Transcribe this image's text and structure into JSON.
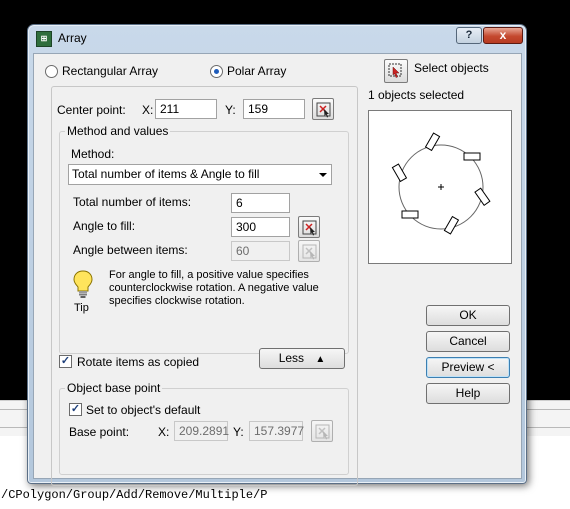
{
  "background": {
    "command_line": "/CPolygon/Group/Add/Remove/Multiple/P"
  },
  "titlebar": {
    "title": "Array",
    "icon": "array-app-icon",
    "help_glyph": "?",
    "close_glyph": "x"
  },
  "array_type": {
    "rectangular_label": "Rectangular Array",
    "polar_label": "Polar Array",
    "selected": "Polar Array"
  },
  "selection": {
    "select_objects_label": "Select objects",
    "status": "1 objects selected"
  },
  "center_point": {
    "label": "Center point:",
    "x_label": "X:",
    "x_value": "211",
    "y_label": "Y:",
    "y_value": "159"
  },
  "method_group": {
    "title": "Method and values",
    "method_label": "Method:",
    "method_value": "Total number of items & Angle to fill",
    "total_items_label": "Total number of items:",
    "total_items_value": "6",
    "angle_fill_label": "Angle to fill:",
    "angle_fill_value": "300",
    "angle_between_label": "Angle between items:",
    "angle_between_value": "60",
    "tip_label": "Tip",
    "tip_text": "For angle to fill, a positive value specifies counterclockwise rotation.  A negative value specifies clockwise rotation."
  },
  "options": {
    "rotate_label": "Rotate items as copied",
    "rotate_checked": true,
    "less_label": "Less",
    "less_glyph": "⯭"
  },
  "base_point_group": {
    "title": "Object base point",
    "default_label": "Set to object's default",
    "default_checked": true,
    "base_point_label": "Base point:",
    "x_label": "X:",
    "x_value": "209.2891",
    "y_label": "Y:",
    "y_value": "157.3977"
  },
  "buttons": {
    "ok": "OK",
    "cancel": "Cancel",
    "preview": "Preview <",
    "help": "Help"
  },
  "colors": {
    "title_bar": "#c9d9ea",
    "close_button": "#c4482f",
    "dialog_body": "#f0f0f0",
    "radio_dot": "#1f5cba"
  }
}
